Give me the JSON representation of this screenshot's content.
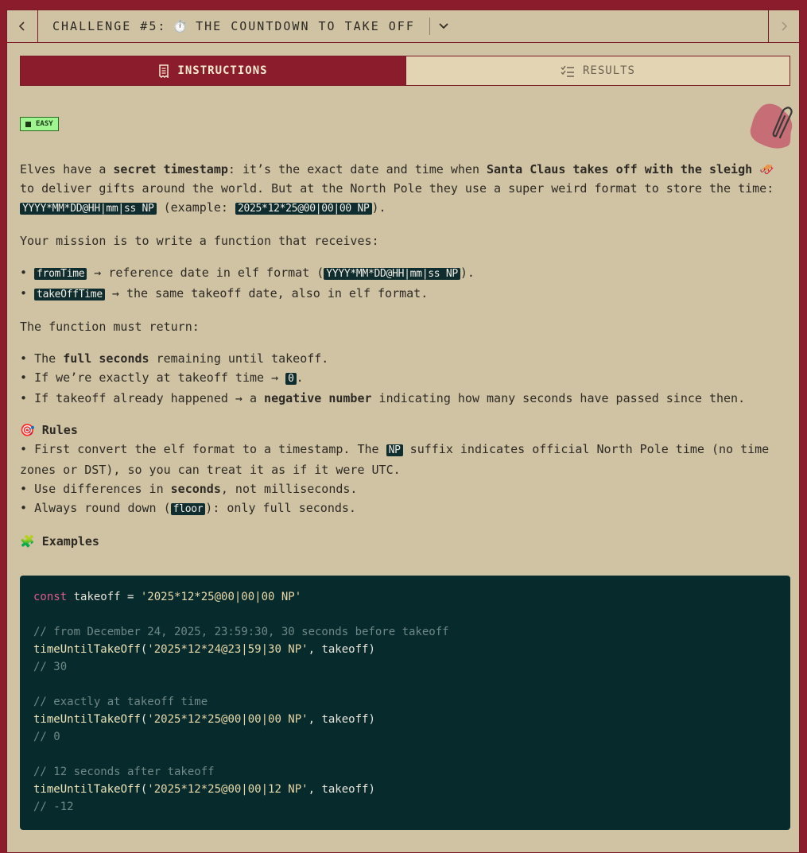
{
  "topbar": {
    "title_prefix": "CHALLENGE #5:",
    "title_icon": "stopwatch-icon",
    "title_text": "THE COUNTDOWN TO TAKE OFF",
    "prev_label": "<",
    "next_label": ">"
  },
  "tabs": [
    {
      "label": "INSTRUCTIONS",
      "icon": "receipt-icon",
      "active": true
    },
    {
      "label": "RESULTS",
      "icon": "checklist-icon",
      "active": false
    }
  ],
  "badge": {
    "label": "EASY"
  },
  "intro": {
    "t1": "Elves have a ",
    "b1": "secret timestamp",
    "t2": ": it’s the exact date and time when ",
    "b2": "Santa Claus takes off with the sleigh",
    "t3": " 🛷 to deliver gifts around the world. But at the North Pole they use a super weird format to store the time: ",
    "c1": "YYYY*MM*DD@HH|mm|ss NP",
    "t4": " (example: ",
    "c2": "2025*12*25@00|00|00 NP",
    "t5": ")."
  },
  "mission": "Your mission is to write a function that receives:",
  "params": [
    {
      "code": "fromTime",
      "text": " → reference date in elf format (",
      "code2": "YYYY*MM*DD@HH|mm|ss NP",
      "text2": ")."
    },
    {
      "code": "takeOffTime",
      "text": " → the same takeoff date, also in elf format."
    }
  ],
  "return_intro": "The function must return:",
  "returns": {
    "r1_pre": "The ",
    "r1_b": "full seconds",
    "r1_post": " remaining until takeoff.",
    "r2_pre": "If we’re exactly at takeoff time → ",
    "r2_code": "0",
    "r2_post": ".",
    "r3_pre": "If takeoff already happened → a ",
    "r3_b": "negative number",
    "r3_post": " indicating how many seconds have passed since then."
  },
  "rules": {
    "heading": "Rules",
    "icon": "target-icon",
    "r1_pre": "First convert the elf format to a timestamp. The ",
    "r1_code": "NP",
    "r1_post": " suffix indicates official North Pole time (no time zones or DST), so you can treat it as if it were UTC.",
    "r2_pre": "Use differences in ",
    "r2_b": "seconds",
    "r2_post": ", not milliseconds.",
    "r3_pre": "Always round down (",
    "r3_code": "floor",
    "r3_post": "): only full seconds."
  },
  "examples": {
    "heading": "Examples",
    "icon": "puzzle-icon",
    "code": {
      "l1_kw": "const",
      "l1_var": " takeoff = ",
      "l1_str": "'2025*12*25@00|00|00 NP'",
      "c1": "// from December 24, 2025, 23:59:30, 30 seconds before takeoff",
      "f1": "timeUntilTakeOff",
      "a1": "'2025*12*24@23|59|30 NP'",
      "a1_rest": ", takeoff)",
      "r1": "// 30",
      "c2": "// exactly at takeoff time",
      "f2": "timeUntilTakeOff",
      "a2": "'2025*12*25@00|00|00 NP'",
      "a2_rest": ", takeoff)",
      "r2": "// 0",
      "c3": "// 12 seconds after takeoff",
      "f3": "timeUntilTakeOff",
      "a3": "'2025*12*25@00|00|12 NP'",
      "a3_rest": ", takeoff)",
      "r3": "// -12"
    }
  },
  "colors": {
    "accent": "#8a1c2b",
    "background": "#d0c3a3",
    "code_bg": "#072a2d",
    "badge": "#9ff58f"
  }
}
